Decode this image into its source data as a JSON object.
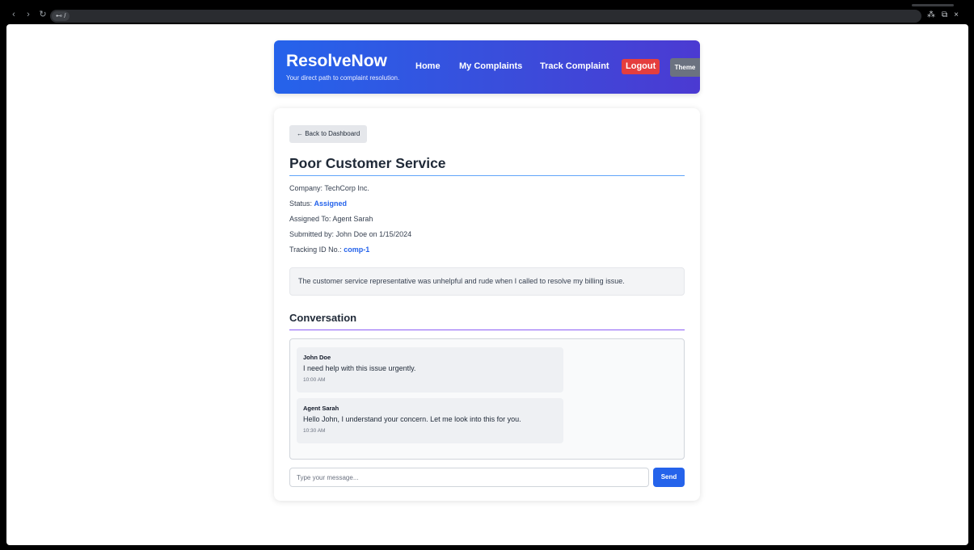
{
  "browser": {
    "url_text": "⊷ /",
    "nav": {
      "back": "‹",
      "forward": "›",
      "reload": "↻"
    },
    "window_controls": {
      "extensions": "⁂",
      "restore": "⧉",
      "close": "×"
    }
  },
  "header": {
    "brand": "ResolveNow",
    "tagline": "Your direct path to complaint resolution.",
    "nav": [
      "Home",
      "My Complaints",
      "Track Complaint"
    ],
    "logout_label": "Logout",
    "theme_label": "Theme"
  },
  "complaint": {
    "back_label": "← Back to Dashboard",
    "title": "Poor Customer Service",
    "company_label": "Company:",
    "company": "TechCorp Inc.",
    "status_label": "Status:",
    "status": "Assigned",
    "assigned_label": "Assigned To:",
    "assigned_to": "Agent Sarah",
    "submitted_label": "Submitted by:",
    "submitted_by": "John Doe",
    "submitted_on_label": "on",
    "submitted_date": "1/15/2024",
    "tracking_label": "Tracking ID No.:",
    "tracking_id": "comp-1",
    "description": "The customer service representative was unhelpful and rude when I called to resolve my billing issue."
  },
  "conversation": {
    "title": "Conversation",
    "messages": [
      {
        "author": "John Doe",
        "text": "I need help with this issue urgently.",
        "time": "10:00 AM"
      },
      {
        "author": "Agent Sarah",
        "text": "Hello John, I understand your concern. Let me look into this for you.",
        "time": "10:30 AM"
      }
    ],
    "input_placeholder": "Type your message...",
    "send_label": "Send"
  },
  "colors": {
    "brand_gradient_start": "#2563eb",
    "brand_gradient_end": "#4b3ad2",
    "logout": "#e53e3e",
    "accent_blue": "#2563eb",
    "divider_purple": "#8b5cf6"
  }
}
